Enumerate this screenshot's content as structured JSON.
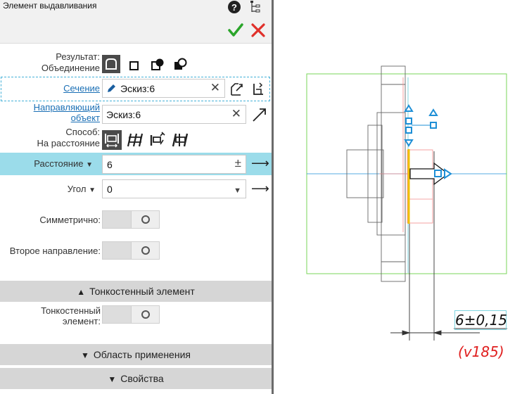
{
  "panel": {
    "title": "Элемент выдавливания",
    "help_icon": "question-circle-icon",
    "tree_icon": "tree-structure-icon",
    "ok_icon": "checkmark-icon",
    "cancel_icon": "cross-icon",
    "ok_color": "#2aa52a",
    "cancel_color": "#e0302a"
  },
  "result": {
    "label": "Результат:",
    "value": "Объединение",
    "modes": [
      "union-icon",
      "cut-icon",
      "intersect-icon",
      "merge-icon"
    ]
  },
  "section": {
    "label": "Сечение",
    "value": "Эскиз:6",
    "edit_icon": "pencil-icon",
    "clear": "✕"
  },
  "guide": {
    "label": "Направляющий объект",
    "value": "Эскиз:6",
    "clear": "✕",
    "pick_icon": "arrow-pick-icon"
  },
  "method": {
    "label": "Способ:",
    "value": "На расстояние",
    "modes": [
      "to-distance-icon",
      "through-all-icon",
      "to-vertex-icon",
      "to-surface-icon"
    ]
  },
  "distance": {
    "label": "Расстояние",
    "value": "6",
    "pm": "±",
    "arrow": "⟶"
  },
  "angle": {
    "label": "Угол",
    "value": "0",
    "arrow": "⟶"
  },
  "symmetric": {
    "label": "Симметрично:",
    "on": false
  },
  "second_direction": {
    "label": "Второе направление:",
    "on": false
  },
  "thin_section": {
    "label": "Тонкостенный элемент",
    "expanded": true
  },
  "thin_wall": {
    "label": "Тонкостенный элемент:",
    "on": false
  },
  "scope_section": {
    "label": "Область применения",
    "expanded": false
  },
  "properties_section": {
    "label": "Свойства",
    "expanded": false
  },
  "viewport": {
    "dimension": "6±0,15",
    "note": "(v185)",
    "accent": "#1e8fd6",
    "bbox_color": "#7ad65a",
    "highlight": "#f0c000"
  }
}
